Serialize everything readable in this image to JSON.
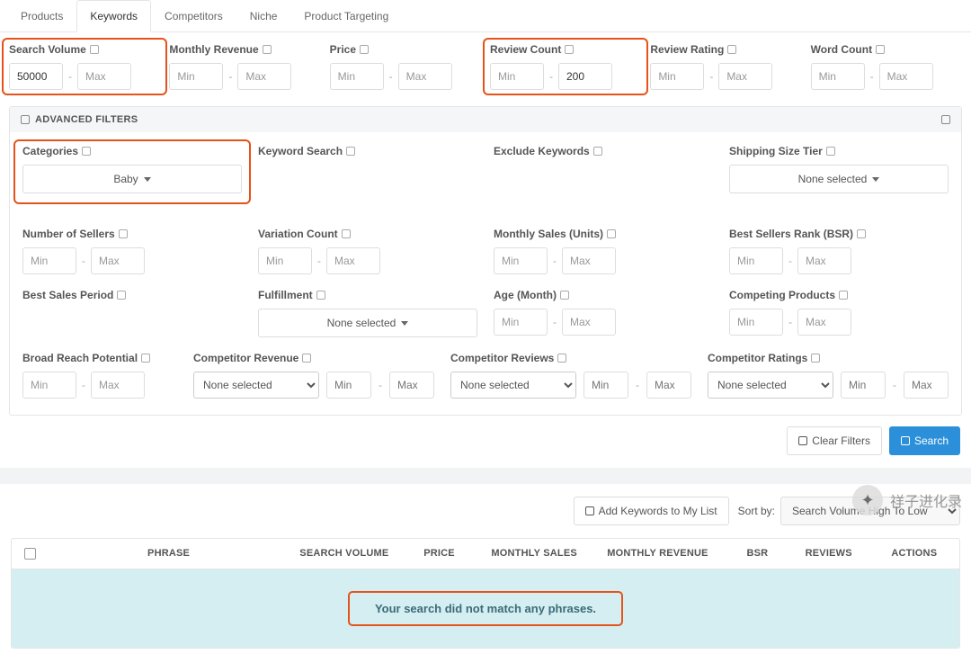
{
  "tabs": [
    "Products",
    "Keywords",
    "Competitors",
    "Niche",
    "Product Targeting"
  ],
  "active_tab_index": 1,
  "filters": {
    "search_volume": {
      "label": "Search Volume",
      "min": "50000",
      "max": ""
    },
    "monthly_revenue": {
      "label": "Monthly Revenue",
      "min": "",
      "max": ""
    },
    "price": {
      "label": "Price",
      "min": "",
      "max": ""
    },
    "review_count": {
      "label": "Review Count",
      "min": "",
      "max": "200"
    },
    "review_rating": {
      "label": "Review Rating",
      "min": "",
      "max": ""
    },
    "word_count": {
      "label": "Word Count",
      "min": "",
      "max": ""
    },
    "min_ph": "Min",
    "max_ph": "Max"
  },
  "adv": {
    "header": "ADVANCED FILTERS",
    "categories": {
      "label": "Categories",
      "selected": "Baby"
    },
    "keyword_search": {
      "label": "Keyword Search"
    },
    "exclude_keywords": {
      "label": "Exclude Keywords"
    },
    "shipping_size_tier": {
      "label": "Shipping Size Tier",
      "selected": "None selected"
    },
    "number_of_sellers": {
      "label": "Number of Sellers"
    },
    "variation_count": {
      "label": "Variation Count"
    },
    "monthly_sales_units": {
      "label": "Monthly Sales (Units)"
    },
    "bsr": {
      "label": "Best Sellers Rank (BSR)"
    },
    "best_sales_period": {
      "label": "Best Sales Period"
    },
    "fulfillment": {
      "label": "Fulfillment",
      "selected": "None selected"
    },
    "age_month": {
      "label": "Age (Month)"
    },
    "competing_products": {
      "label": "Competing Products"
    },
    "broad_reach_potential": {
      "label": "Broad Reach Potential"
    },
    "competitor_revenue": {
      "label": "Competitor Revenue",
      "selected": "None selected"
    },
    "competitor_reviews": {
      "label": "Competitor Reviews",
      "selected": "None selected"
    },
    "competitor_ratings": {
      "label": "Competitor Ratings",
      "selected": "None selected"
    }
  },
  "actions": {
    "clear": "Clear Filters",
    "search": "Search"
  },
  "results_bar": {
    "add_btn": "Add Keywords to My List",
    "sort_label": "Sort by:",
    "sort_selected": "Search Volume High To Low"
  },
  "table": {
    "headers": {
      "phrase": "PHRASE",
      "search_volume": "SEARCH VOLUME",
      "price": "PRICE",
      "monthly_sales": "MONTHLY SALES",
      "monthly_revenue": "MONTHLY REVENUE",
      "bsr": "BSR",
      "reviews": "REVIEWS",
      "actions": "ACTIONS"
    },
    "no_results": "Your search did not match any phrases."
  },
  "watermark": "祥子进化录"
}
